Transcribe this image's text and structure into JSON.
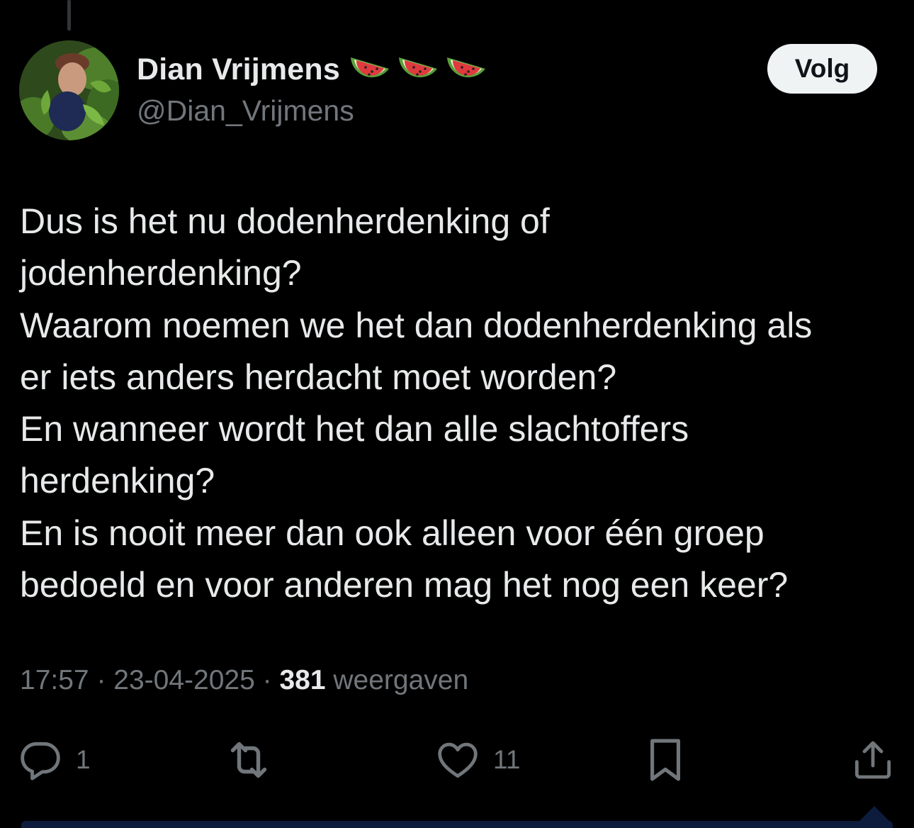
{
  "author": {
    "display_name": "Dian Vrijmens",
    "handle": "@Dian_Vrijmens",
    "name_emojis": [
      "watermelon-icon",
      "watermelon-icon",
      "watermelon-icon"
    ]
  },
  "follow_button": {
    "label": "Volg"
  },
  "tweet": {
    "lines": [
      "Dus is het nu dodenherdenking of",
      "jodenherdenking?",
      "Waarom noemen we het dan dodenherdenking als",
      "er iets anders herdacht moet worden?",
      "En wanneer wordt het dan alle slachtoffers",
      "herdenking?",
      "En is nooit meer dan ook alleen voor één groep",
      "bedoeld en voor anderen mag het nog een keer?"
    ]
  },
  "meta": {
    "time": "17:57",
    "separator": " · ",
    "date": "23-04-2025",
    "views_count": "381",
    "views_label": "weergaven"
  },
  "actions": {
    "reply_count": "1",
    "retweet_count": "",
    "like_count": "11"
  },
  "colors": {
    "background": "#000000",
    "text_primary": "#e7e9ea",
    "text_secondary": "#71767b",
    "follow_bg": "#eff3f4",
    "follow_text": "#0f1419"
  }
}
